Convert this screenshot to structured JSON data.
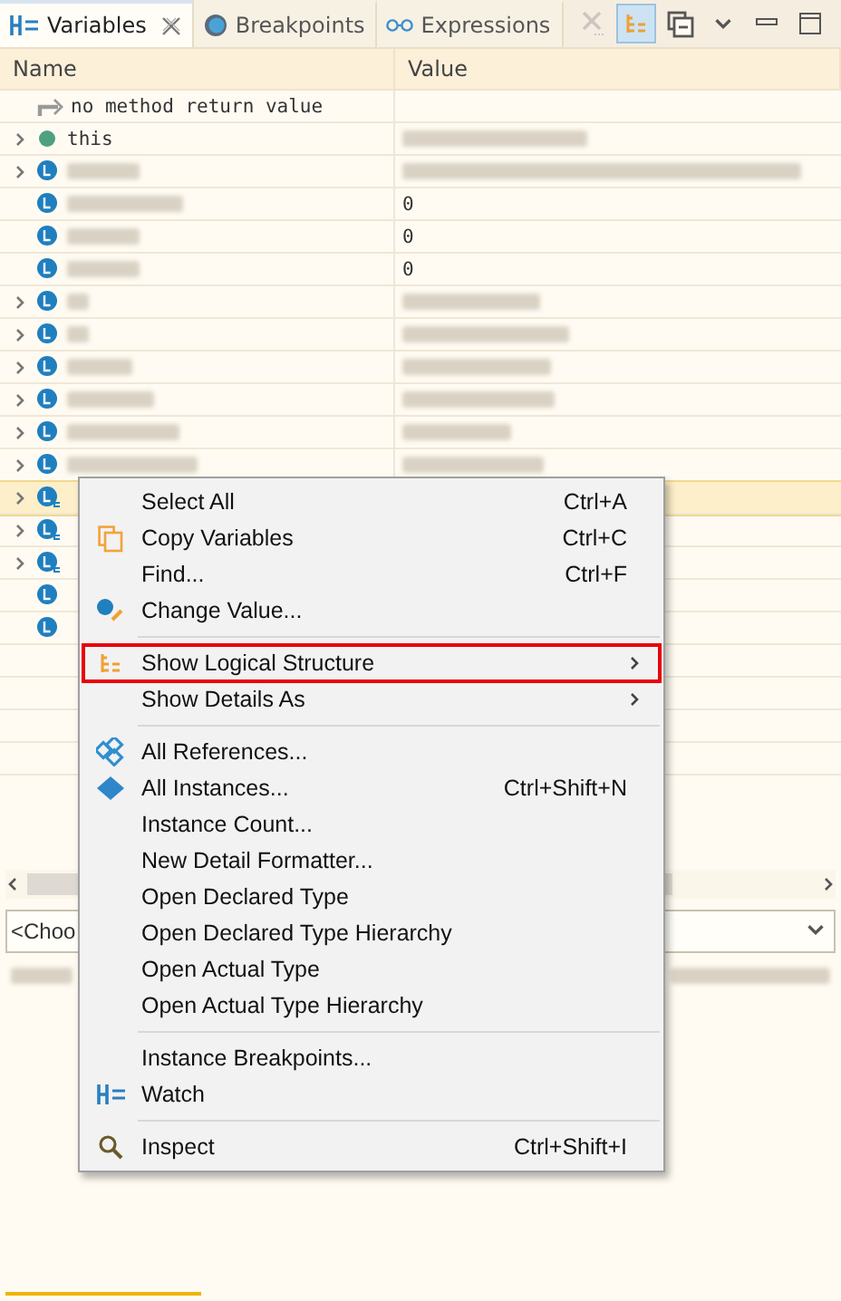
{
  "tabs": [
    {
      "label": "Variables",
      "selected": true,
      "kind": "variables",
      "closable": true
    },
    {
      "label": "Breakpoints",
      "selected": false,
      "kind": "breakpoints",
      "closable": false
    },
    {
      "label": "Expressions",
      "selected": false,
      "kind": "expressions",
      "closable": false
    }
  ],
  "toolbar": [
    {
      "kind": "remove",
      "disabled": true,
      "on": false
    },
    {
      "kind": "logical",
      "disabled": false,
      "on": true
    },
    {
      "kind": "collapse",
      "disabled": false,
      "on": false
    },
    {
      "kind": "menu",
      "disabled": false,
      "on": false
    },
    {
      "kind": "minimize",
      "disabled": false,
      "on": false
    },
    {
      "kind": "maximize",
      "disabled": false,
      "on": false
    }
  ],
  "table": {
    "columns": [
      "Name",
      "Value"
    ],
    "rows": [
      {
        "kind": "return",
        "expandable": false,
        "selected": false,
        "name": "no method return value"
      },
      {
        "kind": "this",
        "expandable": true,
        "selected": false,
        "name": "this",
        "value_redacted": true
      },
      {
        "kind": "local",
        "expandable": true,
        "selected": false,
        "name_redacted": true,
        "value_redacted": true
      },
      {
        "kind": "local",
        "expandable": false,
        "selected": false,
        "name_redacted": true,
        "value": "0"
      },
      {
        "kind": "local",
        "expandable": false,
        "selected": false,
        "name_redacted": true,
        "value": "0"
      },
      {
        "kind": "local",
        "expandable": false,
        "selected": false,
        "name_redacted": true,
        "value": "0"
      },
      {
        "kind": "local",
        "expandable": true,
        "selected": false,
        "name_redacted": true,
        "value_redacted": true
      },
      {
        "kind": "local",
        "expandable": true,
        "selected": false,
        "name_redacted": true,
        "value_redacted": true
      },
      {
        "kind": "local",
        "expandable": true,
        "selected": false,
        "name_redacted": true,
        "value_redacted": true
      },
      {
        "kind": "local",
        "expandable": true,
        "selected": false,
        "name_redacted": true,
        "value_redacted": true
      },
      {
        "kind": "local",
        "expandable": true,
        "selected": false,
        "name_redacted": true,
        "value_redacted": true
      },
      {
        "kind": "local",
        "expandable": true,
        "selected": false,
        "name_redacted": true,
        "value_redacted": true
      },
      {
        "kind": "local-logical",
        "expandable": true,
        "selected": true
      },
      {
        "kind": "local-logical",
        "expandable": true,
        "selected": false
      },
      {
        "kind": "local-logical",
        "expandable": true,
        "selected": false
      },
      {
        "kind": "local",
        "expandable": false,
        "selected": false
      },
      {
        "kind": "local",
        "expandable": false,
        "selected": false
      }
    ]
  },
  "detail": {
    "formatter": "<Choo"
  },
  "context_menu": [
    {
      "kind": "plain",
      "label": "Select All",
      "shortcut": "Ctrl+A",
      "submenu": false,
      "highlighted": false
    },
    {
      "kind": "copy",
      "label": "Copy Variables",
      "shortcut": "Ctrl+C",
      "submenu": false,
      "highlighted": false
    },
    {
      "kind": "plain",
      "label": "Find...",
      "shortcut": "Ctrl+F",
      "submenu": false,
      "highlighted": false
    },
    {
      "kind": "edit",
      "label": "Change Value...",
      "submenu": false,
      "highlighted": false
    },
    {
      "kind": "separator"
    },
    {
      "kind": "logical",
      "label": "Show Logical Structure",
      "submenu": true,
      "highlighted": true
    },
    {
      "kind": "plain",
      "label": "Show Details As",
      "submenu": true,
      "highlighted": false
    },
    {
      "kind": "separator"
    },
    {
      "kind": "references",
      "label": "All References...",
      "submenu": false,
      "highlighted": false
    },
    {
      "kind": "instances",
      "label": "All Instances...",
      "shortcut": "Ctrl+Shift+N",
      "submenu": false,
      "highlighted": false
    },
    {
      "kind": "plain",
      "label": "Instance Count...",
      "submenu": false,
      "highlighted": false
    },
    {
      "kind": "plain",
      "label": "New Detail Formatter...",
      "submenu": false,
      "highlighted": false
    },
    {
      "kind": "plain",
      "label": "Open Declared Type",
      "submenu": false,
      "highlighted": false
    },
    {
      "kind": "plain",
      "label": "Open Declared Type Hierarchy",
      "submenu": false,
      "highlighted": false
    },
    {
      "kind": "plain",
      "label": "Open Actual Type",
      "submenu": false,
      "highlighted": false
    },
    {
      "kind": "plain",
      "label": "Open Actual Type Hierarchy",
      "submenu": false,
      "highlighted": false
    },
    {
      "kind": "separator"
    },
    {
      "kind": "plain",
      "label": "Instance Breakpoints...",
      "submenu": false,
      "highlighted": false
    },
    {
      "kind": "watch",
      "label": "Watch",
      "submenu": false,
      "highlighted": false
    },
    {
      "kind": "separator"
    },
    {
      "kind": "inspect",
      "label": "Inspect",
      "shortcut": "Ctrl+Shift+I",
      "submenu": false,
      "highlighted": false
    }
  ]
}
